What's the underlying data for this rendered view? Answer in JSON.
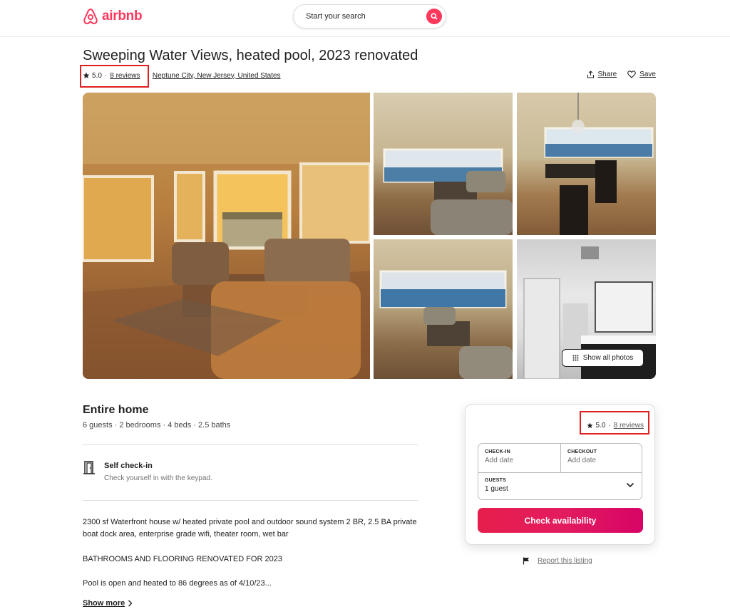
{
  "header": {
    "logo_text": "airbnb",
    "search_placeholder": "Start your search"
  },
  "listing": {
    "title": "Sweeping Water Views, heated pool, 2023 renovated",
    "rating": "5.0",
    "reviews": "8 reviews",
    "location": "Neptune City, New Jersey, United States",
    "share_label": "Share",
    "save_label": "Save"
  },
  "gallery": {
    "show_all_label": "Show all photos"
  },
  "overview": {
    "type": "Entire home",
    "details": "6 guests · 2 bedrooms · 4 beds · 2.5 baths",
    "highlight_title": "Self check-in",
    "highlight_sub": "Check yourself in with the keypad.",
    "desc_1": "2300 sf Waterfront house w/ heated private pool and outdoor sound system 2 BR, 2.5 BA private boat dock area, enterprise grade wifi, theater room, wet bar",
    "desc_2": "BATHROOMS AND FLOORING RENOVATED FOR 2023",
    "desc_3": "Pool is open and heated to 86 degrees as of 4/10/23...",
    "show_more": "Show more"
  },
  "booking": {
    "rating": "5.0",
    "reviews": "8 reviews",
    "checkin_label": "CHECK-IN",
    "checkin_value": "Add date",
    "checkout_label": "CHECKOUT",
    "checkout_value": "Add date",
    "guests_label": "GUESTS",
    "guests_value": "1 guest",
    "cta": "Check availability",
    "report": "Report this listing"
  },
  "colors": {
    "brand": "#ff385c",
    "highlight_box": "#e02020"
  }
}
